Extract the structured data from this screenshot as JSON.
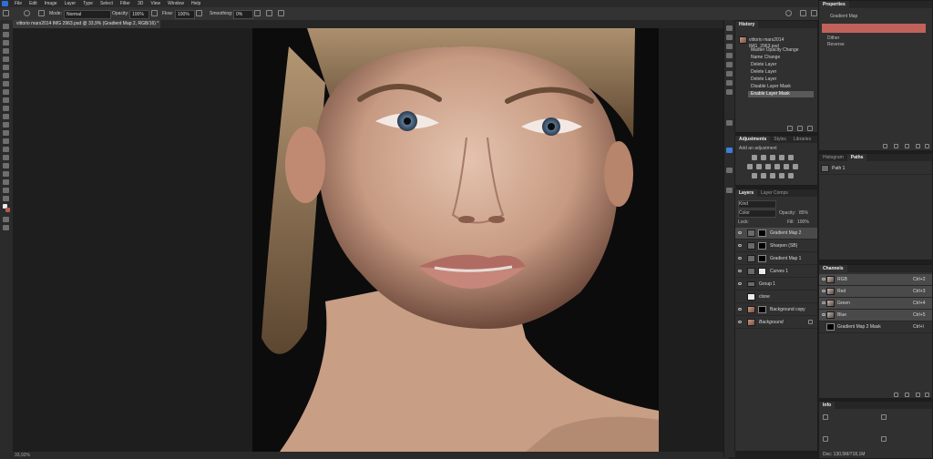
{
  "menubar": {
    "items": [
      "File",
      "Edit",
      "Image",
      "Layer",
      "Type",
      "Select",
      "Filter",
      "3D",
      "View",
      "Window",
      "Help"
    ]
  },
  "options": {
    "mode_label": "Mode:",
    "mode_value": "Normal",
    "opacity_label": "Opacity:",
    "opacity_value": "100%",
    "flow_label": "Flow:",
    "flow_value": "100%",
    "smoothing_label": "Smoothing:",
    "smoothing_value": "0%"
  },
  "document": {
    "tab_title": "vittorio mars2014 IMG 2963.psd @ 33,9% (Gradient Map 2, RGB/16) *",
    "zoom": "33,92%"
  },
  "history": {
    "title": "History",
    "snapshot": "vittorio mars2014 IMG_2963.psd",
    "items": [
      "Master Opacity Change",
      "Name Change",
      "Delete Layer",
      "Delete Layer",
      "Delete Layer",
      "Disable Layer Mask",
      "Enable Layer Mask"
    ]
  },
  "adjustments": {
    "tabs": [
      "Adjustments",
      "Styles",
      "Libraries"
    ],
    "hint": "Add an adjustment"
  },
  "layers": {
    "tabs": [
      "Layers",
      "Layer Comps"
    ],
    "kind_label": "Kind",
    "blend_mode": "Color",
    "opacity_label": "Opacity:",
    "opacity_value": "85%",
    "lock_label": "Lock:",
    "fill_label": "Fill:",
    "fill_value": "100%",
    "items": [
      {
        "name": "Gradient Map 2",
        "thumb": "gradient"
      },
      {
        "name": "Sharpen (SB)",
        "thumb": "gray"
      },
      {
        "name": "Gradient Map 1",
        "thumb": "gradient"
      },
      {
        "name": "Curves 1",
        "thumb": "gradient"
      },
      {
        "name": "Group 1",
        "thumb": "folder"
      },
      {
        "name": "clone",
        "thumb": "white"
      },
      {
        "name": "Background copy",
        "thumb": "photo"
      },
      {
        "name": "Background",
        "thumb": "photo"
      }
    ]
  },
  "properties": {
    "title": "Properties",
    "layer_type": "Gradient Map",
    "gradient_color": "#c0625a",
    "options": [
      "Dither",
      "Reverse"
    ]
  },
  "paths": {
    "tabs": [
      "Histogram",
      "Paths"
    ],
    "items": [
      "Path 1"
    ]
  },
  "channels": {
    "title": "Channels",
    "items": [
      {
        "name": "RGB",
        "shortcut": "Ctrl+2"
      },
      {
        "name": "Red",
        "shortcut": "Ctrl+3"
      },
      {
        "name": "Green",
        "shortcut": "Ctrl+4"
      },
      {
        "name": "Blue",
        "shortcut": "Ctrl+5"
      },
      {
        "name": "Gradient Map 2 Mask",
        "shortcut": "Ctrl+\\"
      }
    ]
  },
  "info": {
    "title": "Info",
    "doc": "Doc: 130,5M/718,1M"
  }
}
